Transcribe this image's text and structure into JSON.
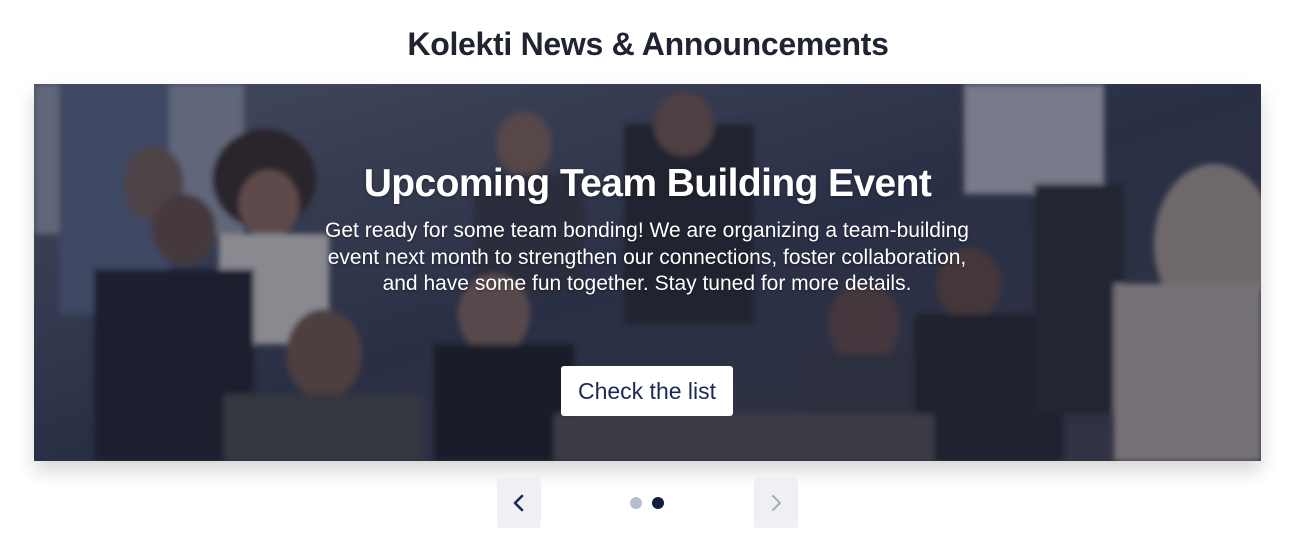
{
  "page": {
    "heading": "Kolekti News & Announcements"
  },
  "slide": {
    "title": "Upcoming Team Building Event",
    "description": "Get ready for some team bonding! We are organizing a team-building event next month to strengthen our connections, foster collaboration, and have some fun together. Stay tuned for more details.",
    "cta_label": "Check the list",
    "background_image": "photo of a group of people sitting together at a social gathering"
  },
  "carousel": {
    "total_slides": 2,
    "active_slide": 2,
    "prev_icon": "chevron-left-icon",
    "next_icon": "chevron-right-icon",
    "prev_enabled": true,
    "next_enabled": false
  },
  "colors": {
    "heading": "#1f2430",
    "overlay": "#161c34",
    "cta_text": "#1b2a54",
    "nav_bg": "#eef0f4",
    "dot_active": "#12203f",
    "dot_inactive": "#b7bdcc",
    "chevron_enabled": "#1b2a54",
    "chevron_disabled": "#a9b0bf"
  }
}
